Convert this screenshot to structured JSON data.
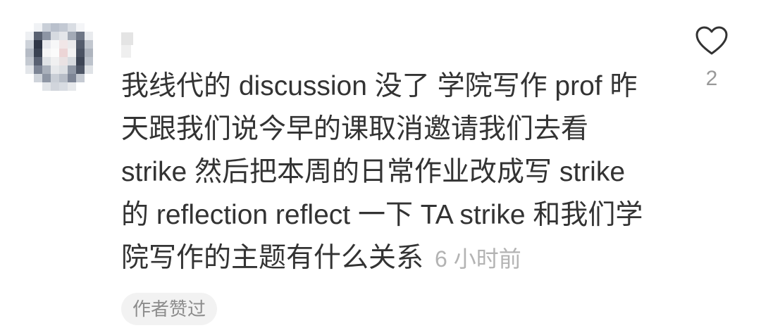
{
  "comment": {
    "lines": [
      "我线代的 discussion 没了 学院写作 prof 昨",
      "天跟我们说今早的课取消邀请我们去看",
      "strike 然后把本周的日常作业改成写 strike",
      "的 reflection reflect 一下 TA strike 和我们学",
      "院写作的主题有什么关系"
    ],
    "timestamp": "6 小时前",
    "badge": "作者赞过",
    "likes": 2,
    "like_icon": "heart-outline-icon"
  },
  "colors": {
    "text": "#333333",
    "meta": "#b3b3b3",
    "badge_bg": "#f2f2f2",
    "badge_text": "#8c8c8c",
    "icon": "#333333",
    "count": "#999999"
  }
}
